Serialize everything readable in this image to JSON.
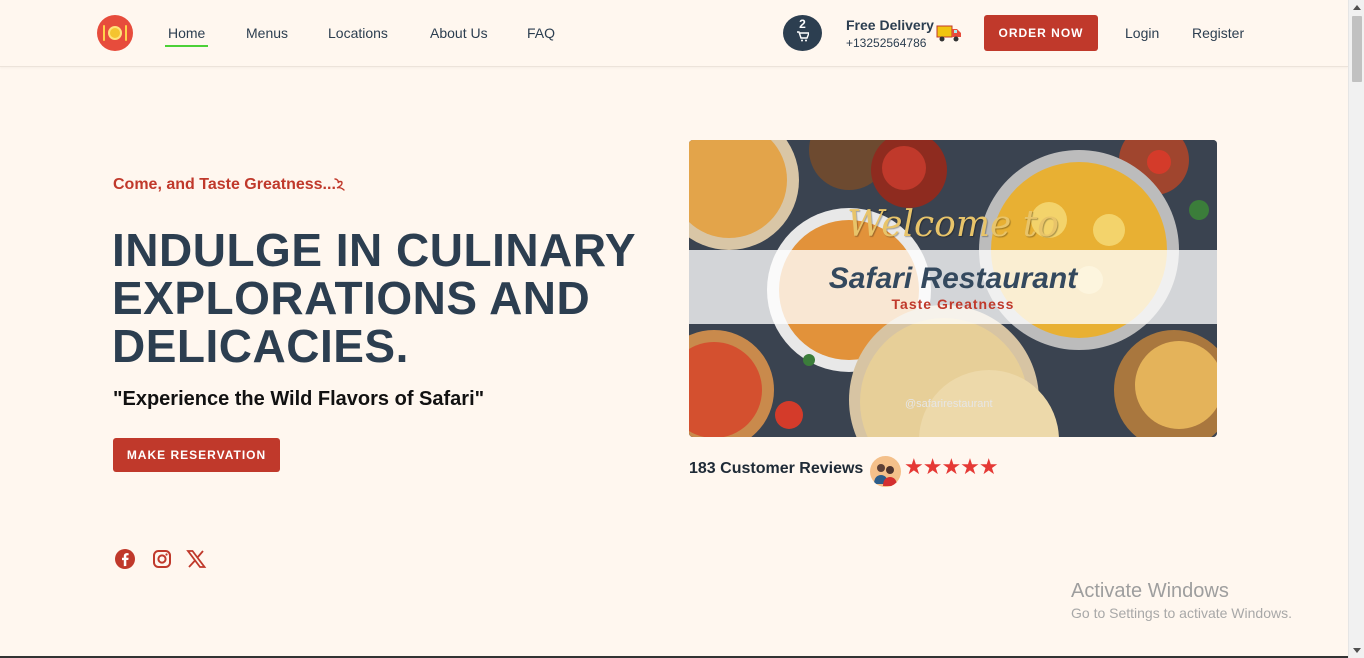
{
  "header": {
    "nav": [
      {
        "label": "Home",
        "active": true
      },
      {
        "label": "Menus",
        "active": false
      },
      {
        "label": "Locations",
        "active": false
      },
      {
        "label": "About Us",
        "active": false
      },
      {
        "label": "FAQ",
        "active": false
      }
    ],
    "cart_count": "2",
    "delivery_title": "Free Delivery",
    "delivery_phone": "+13252564786",
    "order_label": "ORDER NOW",
    "login_label": "Login",
    "register_label": "Register"
  },
  "hero": {
    "tagline": "Come, and Taste Greatness...",
    "headline_lines": [
      "INDULGE IN CULINARY",
      "EXPLORATIONS AND",
      "DELICACIES."
    ],
    "subhead": "\"Experience the Wild Flavors of Safari\"",
    "reserve_label": "MAKE RESERVATION"
  },
  "banner": {
    "welcome": "Welcome to",
    "name": "Safari Restaurant",
    "slogan": "Taste Greatness",
    "handle": "@safarirestaurant"
  },
  "reviews": {
    "label": "183 Customer Reviews",
    "stars": "★★★★★",
    "rating": 5
  },
  "social": [
    "facebook-icon",
    "instagram-icon",
    "x-icon"
  ],
  "windows": {
    "title": "Activate Windows",
    "subtitle": "Go to Settings to activate Windows."
  },
  "colors": {
    "accent": "#c0392b",
    "navy": "#2c3e50",
    "background": "#fff7ef",
    "active_underline": "#4cd137"
  }
}
